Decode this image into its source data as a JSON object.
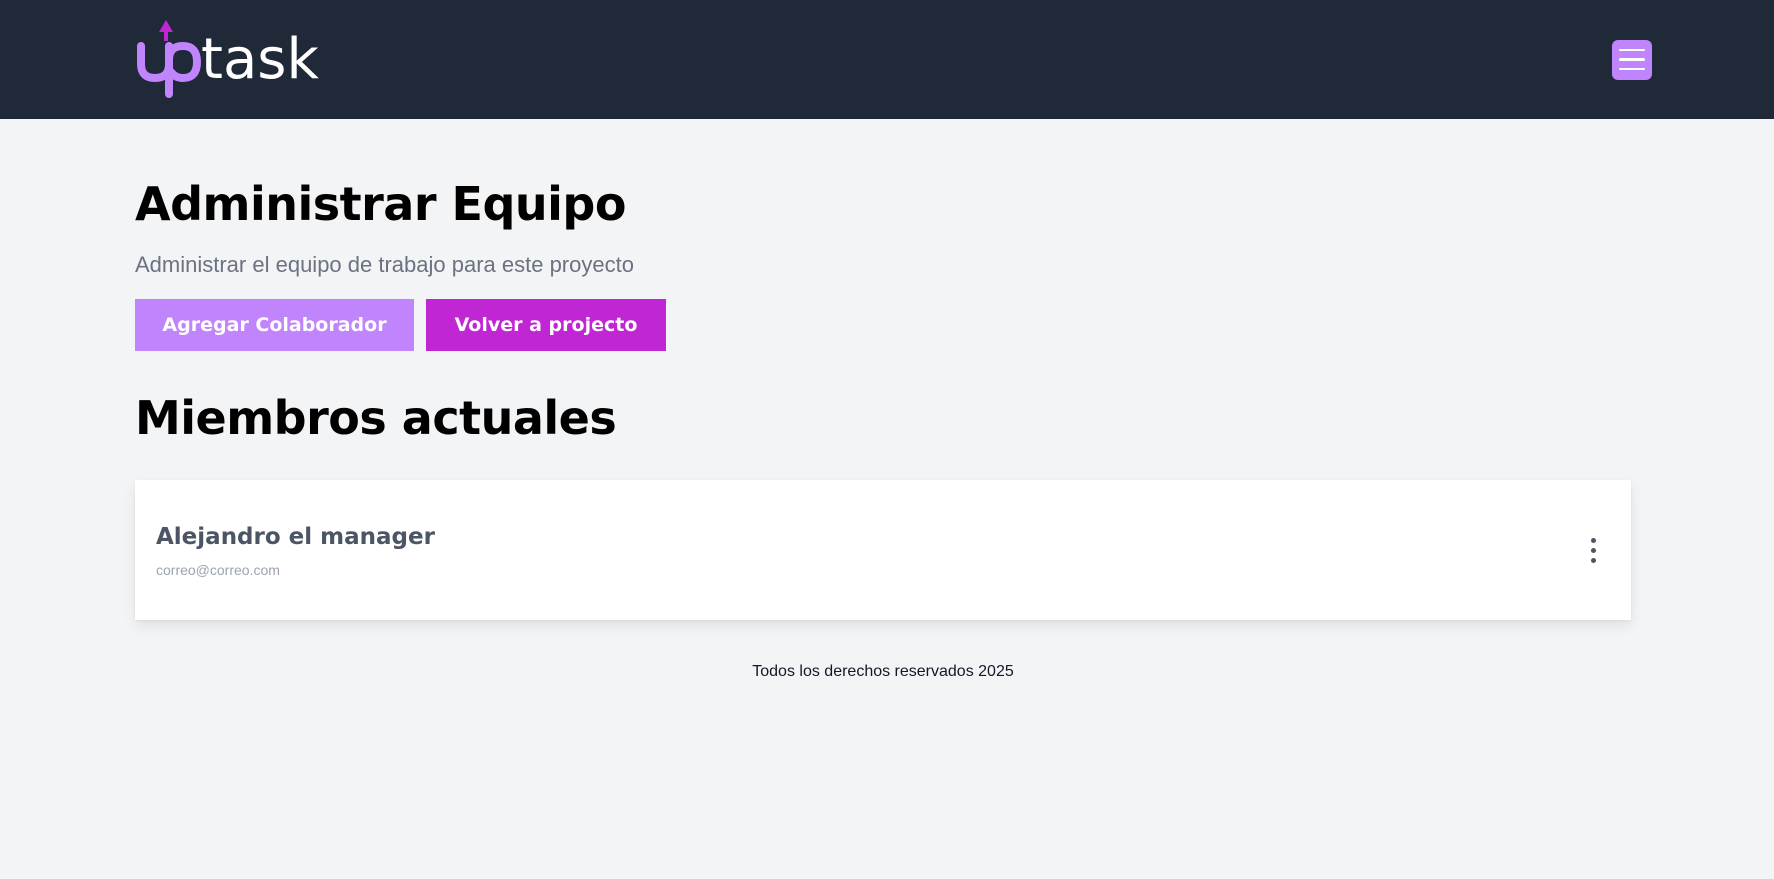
{
  "header": {
    "logo": {
      "up": "up",
      "task": "task",
      "accent_color": "#c084fc",
      "arrow_color": "#c026d3"
    },
    "menu_icon": "hamburger-menu-icon"
  },
  "main": {
    "title": "Administrar Equipo",
    "subtitle": "Administrar el equipo de trabajo para este proyecto",
    "actions": {
      "add_label": "Agregar Colaborador",
      "back_label": "Volver a projecto"
    },
    "section_title": "Miembros actuales",
    "members": [
      {
        "name": "Alejandro el manager",
        "email": "correo@correo.com",
        "options_icon": "vertical-ellipsis-icon"
      }
    ]
  },
  "footer": {
    "text": "Todos los derechos reservados 2025"
  },
  "colors": {
    "header_bg": "#1f2937",
    "page_bg": "#f3f4f6",
    "primary_light": "#c084fc",
    "primary": "#c026d3"
  }
}
